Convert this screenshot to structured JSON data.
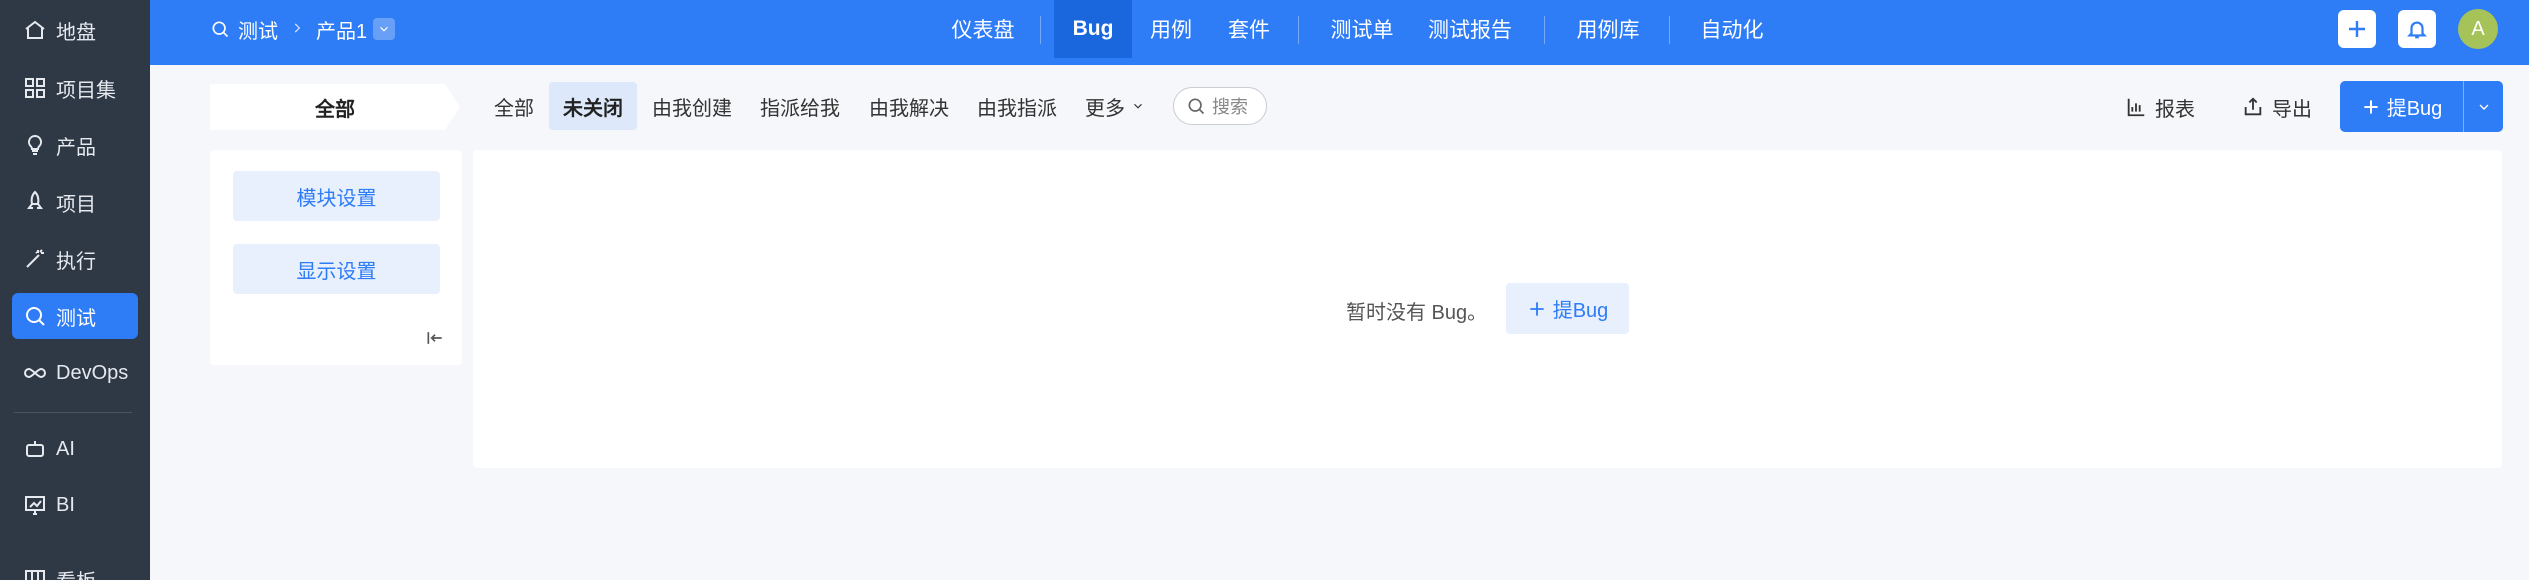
{
  "sidebar": {
    "items": [
      {
        "label": "地盘",
        "icon": "home-icon"
      },
      {
        "label": "项目集",
        "icon": "grid-icon"
      },
      {
        "label": "产品",
        "icon": "lightbulb-icon"
      },
      {
        "label": "项目",
        "icon": "rocket-icon"
      },
      {
        "label": "执行",
        "icon": "wand-icon"
      },
      {
        "label": "测试",
        "icon": "search-icon",
        "active": true
      },
      {
        "label": "DevOps",
        "icon": "infinity-icon"
      },
      {
        "label": "AI",
        "icon": "robot-icon"
      },
      {
        "label": "BI",
        "icon": "chart-board-icon"
      },
      {
        "label": "看板",
        "icon": "kanban-icon"
      }
    ]
  },
  "breadcrumb": {
    "module": "测试",
    "product": "产品1"
  },
  "topnav": {
    "items": [
      "仪表盘",
      "Bug",
      "用例",
      "套件",
      "测试单",
      "测试报告",
      "用例库",
      "自动化"
    ],
    "active": "Bug"
  },
  "user": {
    "avatar_letter": "A"
  },
  "filters": {
    "all_label": "全部",
    "tabs": [
      "全部",
      "未关闭",
      "由我创建",
      "指派给我",
      "由我解决",
      "由我指派",
      "更多"
    ],
    "active": "未关闭",
    "search_placeholder": "搜索"
  },
  "actions": {
    "report": "报表",
    "export": "导出",
    "create_bug": "提Bug"
  },
  "left_panel": {
    "module_settings": "模块设置",
    "display_settings": "显示设置"
  },
  "empty_state": {
    "message": "暂时没有 Bug。",
    "button": "提Bug"
  },
  "colors": {
    "primary": "#2e7cf6",
    "sidebar": "#2f3845",
    "active_nav": "#1a66dc"
  }
}
